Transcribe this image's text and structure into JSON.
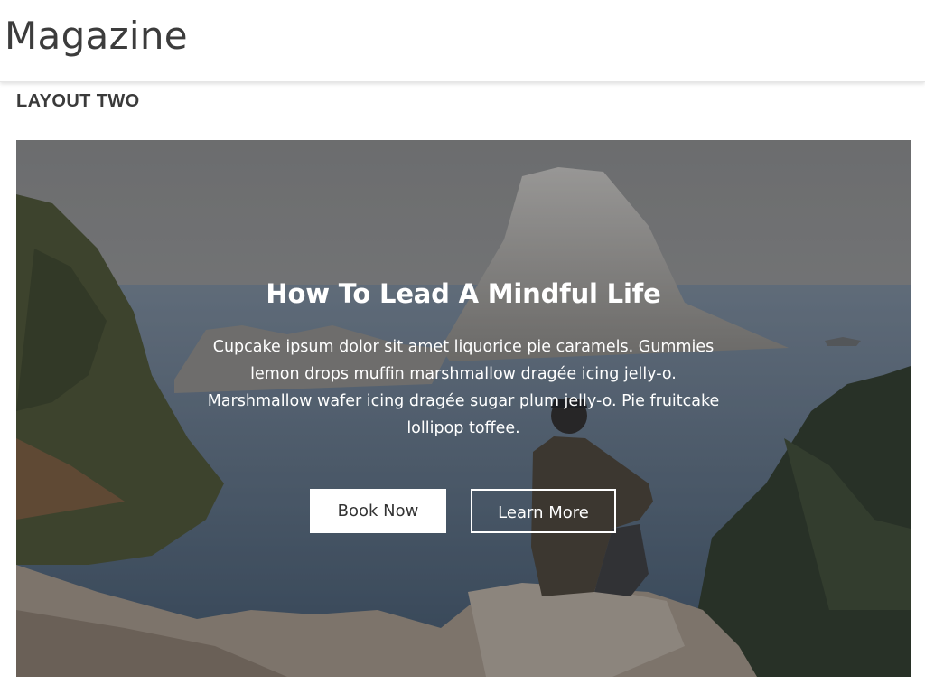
{
  "header": {
    "brand": "Magazine"
  },
  "section": {
    "heading": "LAYOUT TWO"
  },
  "hero": {
    "title": "How To Lead A Mindful Life",
    "text": "Cupcake ipsum dolor sit amet liquorice pie caramels. Gummies lemon drops muffin marshmallow dragée icing jelly-o. Marshmallow wafer icing dragée sugar plum jelly-o. Pie fruitcake lollipop toffee.",
    "primary_button": "Book Now",
    "secondary_button": "Learn More"
  },
  "colors": {
    "overlay": "#191e28",
    "primary_button_bg": "#ffffff",
    "primary_button_text": "#333333",
    "text_on_image": "#ffffff"
  }
}
